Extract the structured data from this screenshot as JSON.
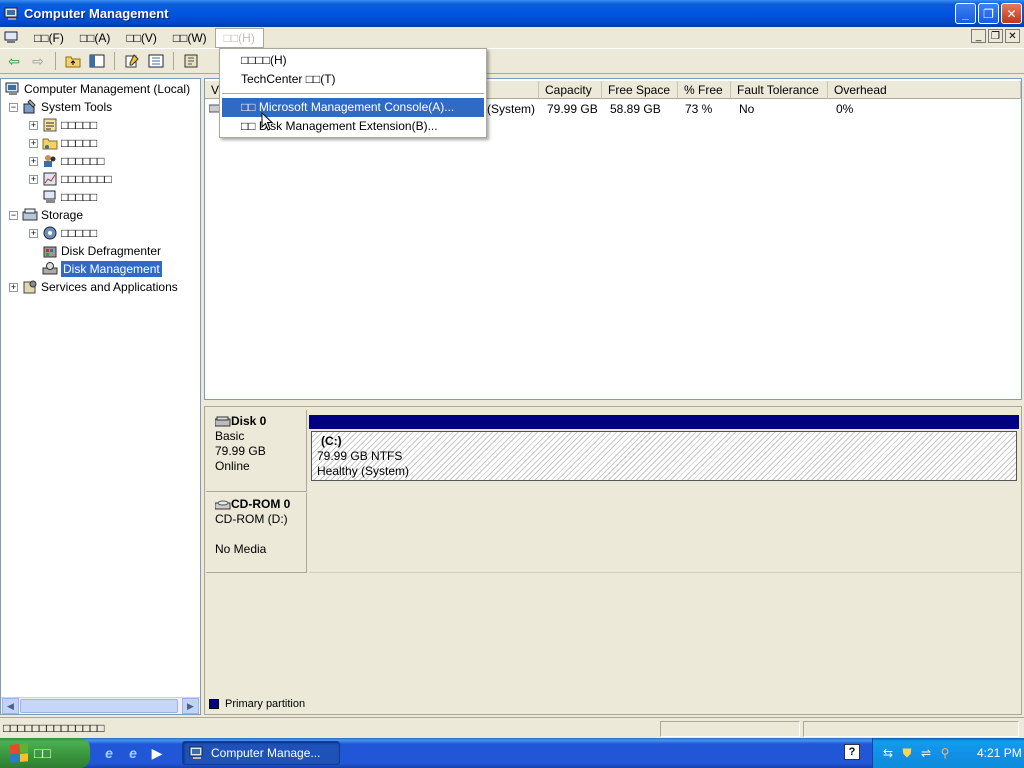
{
  "window": {
    "title": "Computer Management"
  },
  "menubar": {
    "items": [
      "□□(F)",
      "□□(A)",
      "□□(V)",
      "□□(W)",
      "□□(H)"
    ]
  },
  "help_menu": {
    "items": [
      "□□□□(H)",
      "TechCenter □□(T)",
      "□□ Microsoft Management Console(A)...",
      "□□ Disk Management Extension(B)..."
    ]
  },
  "tree": {
    "root": "Computer Management (Local)",
    "system_tools": "System Tools",
    "system_tools_children": [
      "□□□□□",
      "□□□□□",
      "□□□□□□",
      "□□□□□□□",
      "□□□□□"
    ],
    "storage": "Storage",
    "storage_children": [
      "□□□□□",
      "Disk Defragmenter",
      "Disk Management"
    ],
    "services": "Services and Applications"
  },
  "volume_list": {
    "columns": [
      "V",
      "Capacity",
      "Free Space",
      "% Free",
      "Fault Tolerance",
      "Overhead"
    ],
    "rows": [
      {
        "status": "(System)",
        "capacity": "79.99 GB",
        "free": "58.89 GB",
        "pct_free": "73 %",
        "fault": "No",
        "overhead": "0%"
      }
    ]
  },
  "disks": [
    {
      "name": "Disk 0",
      "type": "Basic",
      "size": "79.99 GB",
      "state": "Online",
      "partition": {
        "volume": "(C:)",
        "size_fs": "79.99 GB NTFS",
        "status": "Healthy (System)"
      }
    },
    {
      "name": "CD-ROM 0",
      "type": "CD-ROM (D:)",
      "state": "No Media"
    }
  ],
  "legend": {
    "label": "Primary partition",
    "color": "#000080"
  },
  "statusbar": {
    "text": "□□□□□□□□□□□□□□"
  },
  "taskbar": {
    "start_label": "□□",
    "task_label": "Computer Manage...",
    "clock": "4:21 PM"
  }
}
